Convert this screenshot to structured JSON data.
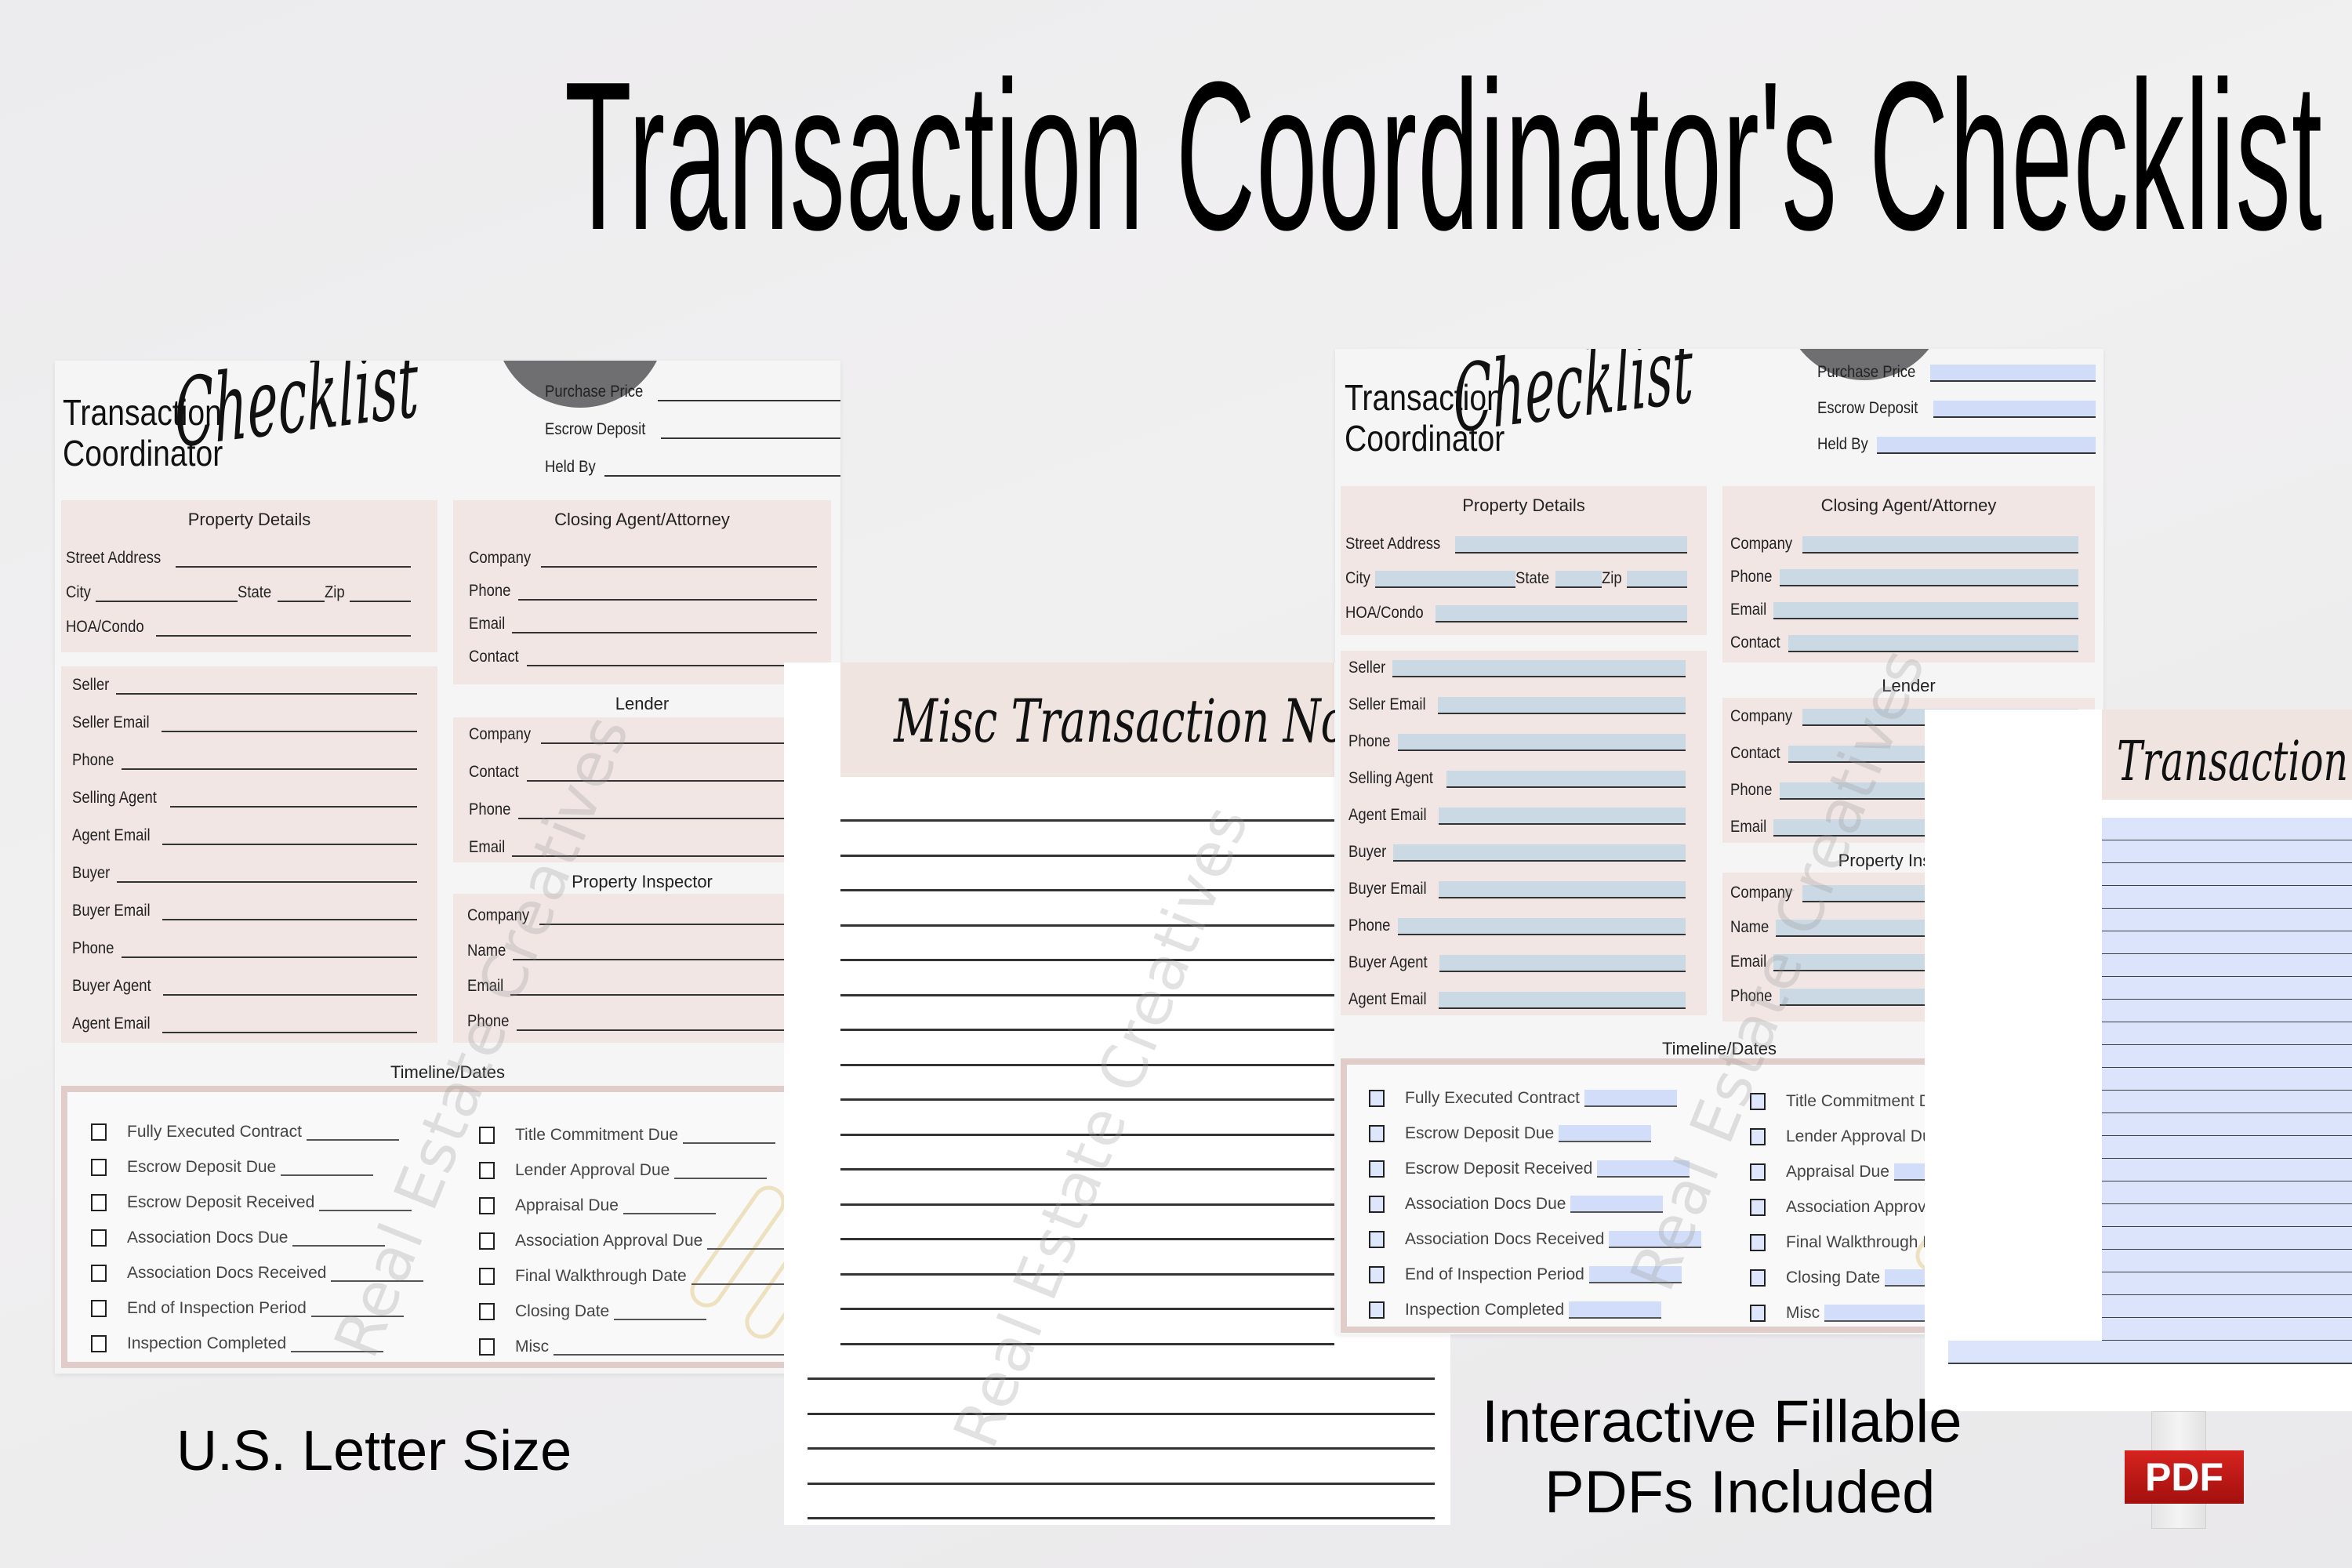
{
  "headline": "Transaction Coordinator's Checklist",
  "captions": {
    "letter_size": "U.S. Letter Size",
    "fillable_line1": "Interactive Fillable",
    "fillable_line2": "PDFs Included",
    "pdf_badge": "PDF"
  },
  "watermark": "Real Estate Creatives",
  "checklist": {
    "title_line1": "Transaction",
    "title_line2": "Coordinator",
    "script_title": "Checklist",
    "top_fields": [
      "Purchase Price",
      "Escrow Deposit",
      "Held By"
    ],
    "property_details": {
      "title": "Property Details",
      "street": "Street Address",
      "city": "City",
      "state": "State",
      "zip": "Zip",
      "hoa": "HOA/Condo"
    },
    "parties": [
      "Seller",
      "Seller Email",
      "Phone",
      "Selling Agent",
      "Agent Email",
      "Buyer",
      "Buyer Email",
      "Phone",
      "Buyer Agent",
      "Agent Email"
    ],
    "closing_agent": {
      "title": "Closing Agent/Attorney",
      "fields": [
        "Company",
        "Phone",
        "Email",
        "Contact"
      ]
    },
    "lender": {
      "title": "Lender",
      "fields": [
        "Company",
        "Contact",
        "Phone",
        "Email"
      ]
    },
    "inspector": {
      "title": "Property Inspector",
      "fields": [
        "Company",
        "Name",
        "Email",
        "Phone"
      ]
    },
    "timeline": {
      "title": "Timeline/Dates",
      "left": [
        "Fully Executed Contract",
        "Escrow Deposit Due",
        "Escrow Deposit Received",
        "Association Docs Due",
        "Association Docs Received",
        "End of Inspection Period",
        "Inspection Completed"
      ],
      "right": [
        "Title Commitment Due",
        "Lender Approval Due",
        "Appraisal Due",
        "Association Approval Due",
        "Final Walkthrough Date",
        "Closing Date",
        "Misc"
      ]
    }
  },
  "notes": {
    "misc_title": "Misc Transaction Notes",
    "partial_title": "Transaction Notes"
  }
}
